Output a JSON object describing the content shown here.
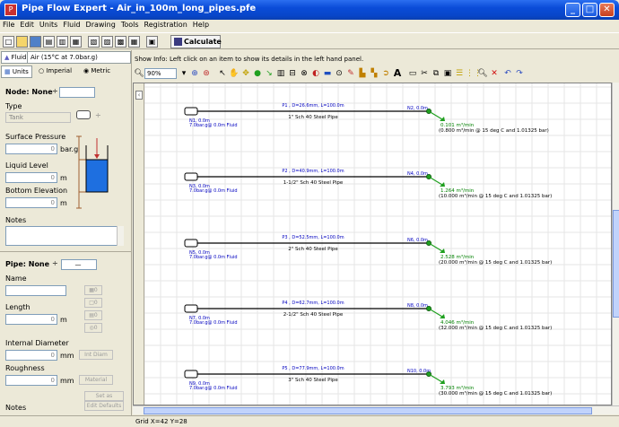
{
  "window": {
    "title": "Pipe Flow Expert - Air_in_100m_long_pipes.pfe",
    "minimize": "_",
    "maximize": "□",
    "close": "✕"
  },
  "menu": [
    "File",
    "Edit",
    "Units",
    "Fluid",
    "Drawing",
    "Tools",
    "Registration",
    "Help"
  ],
  "toolbar": {
    "calculate_label": "Calculate"
  },
  "left_panel": {
    "fluid_tab": "Fluid",
    "fluid_value": "Air (15°C at 7.0bar.g)",
    "units_tab": "Units",
    "unit_imperial": "Imperial",
    "unit_metric": "Metric",
    "node_label": "Node: None",
    "type_label": "Type",
    "type_value": "Tank",
    "surface_pressure_label": "Surface Pressure",
    "surface_pressure_value": "0",
    "surface_pressure_unit": "bar.g",
    "liquid_level_label": "Liquid Level",
    "liquid_level_value": "0",
    "liquid_level_unit": "m",
    "bottom_elevation_label": "Bottom Elevation",
    "bottom_elevation_value": "0",
    "bottom_elevation_unit": "m",
    "notes_label": "Notes",
    "pipe_label": "Pipe: None",
    "name_label": "Name",
    "length_label": "Length",
    "length_value": "0",
    "length_unit": "m",
    "internal_diameter_label": "Internal Diameter",
    "internal_diameter_value": "0",
    "internal_diameter_unit": "mm",
    "int_diam_btn": "Int Diam",
    "roughness_label": "Roughness",
    "roughness_value": "0",
    "roughness_unit": "mm",
    "material_btn": "Material",
    "set_default_btn": "Set as Default",
    "edit_defaults_btn": "Edit Defaults",
    "notes2_label": "Notes"
  },
  "info_bar": "Show Info: Left click on an item to show its details in the left hand panel.",
  "zoom": "90%",
  "pipes": [
    {
      "id": "P1",
      "dims": "P1 , D=26.6mm, L=100.0m",
      "desc": "1\" Sch 40 Steel Pipe",
      "start_node": "N1, 0.0m",
      "start_info": "7.0bar.g@ 0.0m Fluid",
      "end_node": "N2, 0.0m",
      "flow": "0.101 m³/min",
      "flow_info": "(0.800 m³/min @ 15 deg C and 1.01325 bar)"
    },
    {
      "id": "P2",
      "dims": "P2 , D=40.9mm, L=100.0m",
      "desc": "1-1/2\" Sch 40 Steel Pipe",
      "start_node": "N3, 0.0m",
      "start_info": "7.0bar.g@ 0.0m Fluid",
      "end_node": "N4, 0.0m",
      "flow": "1.264 m³/min",
      "flow_info": "(10.000 m³/min @ 15 deg C and 1.01325 bar)"
    },
    {
      "id": "P3",
      "dims": "P3 , D=52.5mm, L=100.0m",
      "desc": "2\" Sch 40 Steel Pipe",
      "start_node": "N5, 0.0m",
      "start_info": "7.0bar.g@ 0.0m Fluid",
      "end_node": "N6, 0.0m",
      "flow": "2.528 m³/min",
      "flow_info": "(20.000 m³/min @ 15 deg C and 1.01325 bar)"
    },
    {
      "id": "P4",
      "dims": "P4 , D=62.7mm, L=100.0m",
      "desc": "2-1/2\" Sch 40 Steel Pipe",
      "start_node": "N7, 0.0m",
      "start_info": "7.0bar.g@ 0.0m Fluid",
      "end_node": "N8, 0.0m",
      "flow": "4.046 m³/min",
      "flow_info": "(32.000 m³/min @ 15 deg C and 1.01325 bar)"
    },
    {
      "id": "P5",
      "dims": "P5 , D=77.9mm, L=100.0m",
      "desc": "3\" Sch 40 Steel Pipe",
      "start_node": "N9, 0.0m",
      "start_info": "7.0bar.g@ 0.0m Fluid",
      "end_node": "N10, 0.0m",
      "flow": "3.793 m³/min",
      "flow_info": "(30.000 m³/min @ 15 deg C and 1.01325 bar)"
    }
  ],
  "status": "Grid  X=42  Y=28",
  "colors": {
    "pipe": "#000000",
    "pipe_label": "#0000c0",
    "flow": "#008000",
    "tank_fill": "#1e6fe0",
    "grid": "#e6e6e6"
  }
}
